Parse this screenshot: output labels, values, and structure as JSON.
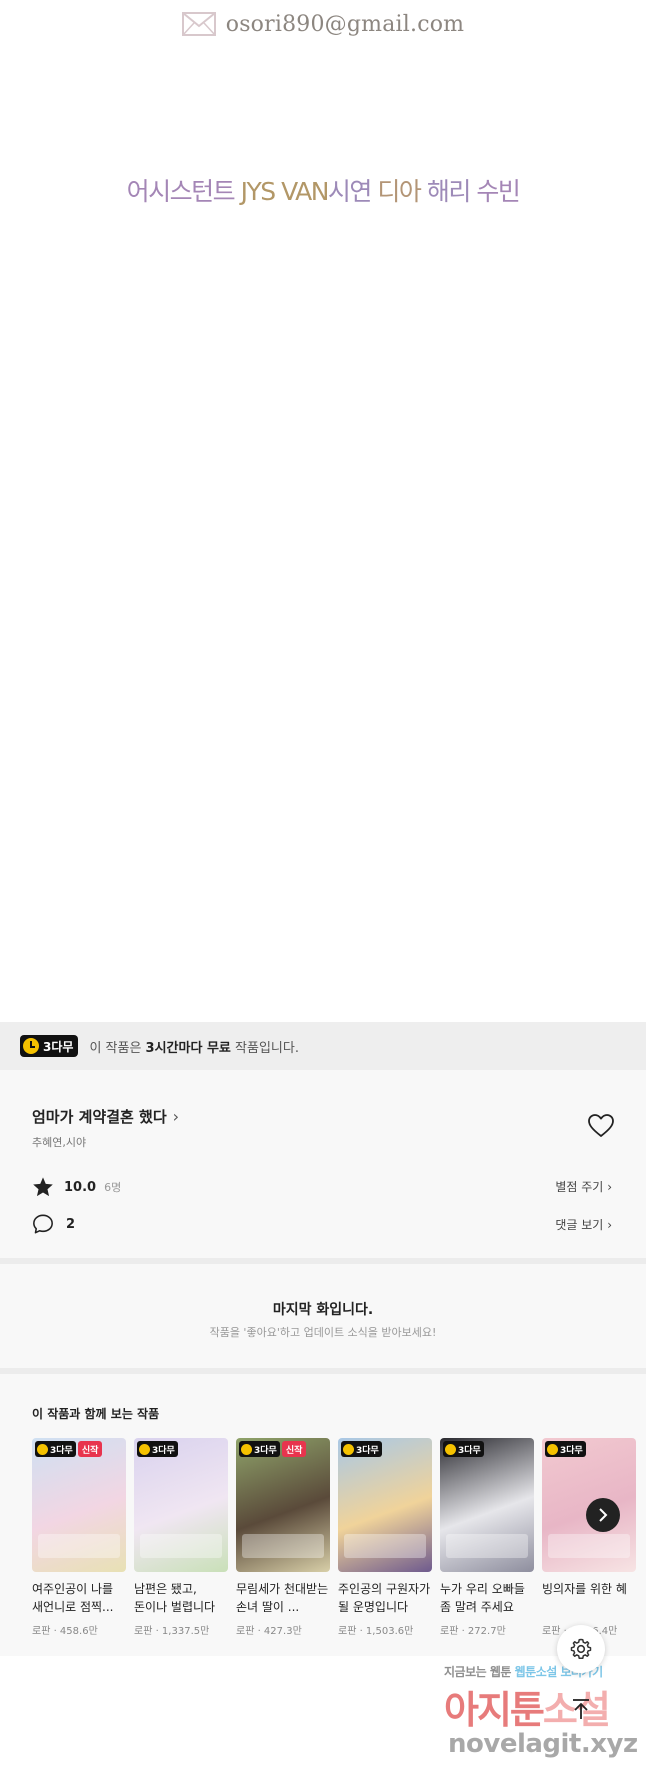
{
  "header_image": {
    "email": "osori890@gmail.com",
    "credits": [
      "어시스턴트",
      "JYS VAN",
      "시연",
      "디아",
      "해리",
      "수빈"
    ]
  },
  "free_banner": {
    "badge": "3다무",
    "text_prefix": "이 작품은 ",
    "text_bold": "3시간마다 무료",
    "text_suffix": " 작품입니다."
  },
  "series": {
    "title": "엄마가 계약결혼 했다",
    "authors": "추혜연,시야",
    "rating": "10.0",
    "rating_count": "6명",
    "rate_link": "별점 주기",
    "comment_count": "2",
    "comment_link": "댓글 보기"
  },
  "last_episode": {
    "title": "마지막 화입니다.",
    "subtitle": "작품을 '좋아요'하고 업데이트 소식을 받아보세요!"
  },
  "recommendations": {
    "heading": "이 작품과 함께 보는 작품",
    "items": [
      {
        "badge": "3다무",
        "new": "신작",
        "title": "여주인공이 나를 새언니로 점찍...",
        "meta": "로판 · 458.6만",
        "colors": [
          "#cfe0f2",
          "#f2d6e3",
          "#e8e1b4"
        ]
      },
      {
        "badge": "3다무",
        "new": "",
        "title": "남편은 됐고, 돈이나 벌렵니다",
        "meta": "로판 · 1,337.5만",
        "colors": [
          "#d9d2ee",
          "#f0e6f2",
          "#c9e0b8"
        ]
      },
      {
        "badge": "3다무",
        "new": "신작",
        "title": "무림세가 천대받는 손녀 딸이 ...",
        "meta": "로판 · 427.3만",
        "colors": [
          "#8fa36a",
          "#5a4a3a",
          "#d8cfa8"
        ]
      },
      {
        "badge": "3다무",
        "new": "",
        "title": "주인공의 구원자가 될 운명입니다",
        "meta": "로판 · 1,503.6만",
        "colors": [
          "#a9c8e6",
          "#f0d39a",
          "#6e5a8e"
        ]
      },
      {
        "badge": "3다무",
        "new": "",
        "title": "누가 우리 오빠들 좀 말려 주세요",
        "meta": "로판 · 272.7만",
        "colors": [
          "#2a2a30",
          "#e6e6ea",
          "#8e8e9e"
        ]
      },
      {
        "badge": "3다무",
        "new": "",
        "title": "빙의자를 위한 혜",
        "meta": "로판 · 1,016.4만",
        "colors": [
          "#f2c9d0",
          "#e8b6c6",
          "#f7e4e4"
        ]
      }
    ]
  },
  "watermark": {
    "line1_a": "지금보는 웹툰",
    "line1_b": "웹툰소설 보러가기",
    "line2_a": "아지툰",
    "line2_b": "소설",
    "line3": "novelagit.xyz"
  },
  "icons": {
    "email": "envelope-icon",
    "clock": "clock-icon",
    "heart": "heart-icon",
    "star": "star-icon",
    "comment": "comment-icon",
    "next": "chevron-right-icon",
    "settings": "gear-icon",
    "top": "arrow-up-icon"
  },
  "colors": {
    "badge_yellow": "#f5c200",
    "new_badge": "#e8344e",
    "panel_bg": "#f8f8f8",
    "banner_bg": "#eeeeee"
  }
}
